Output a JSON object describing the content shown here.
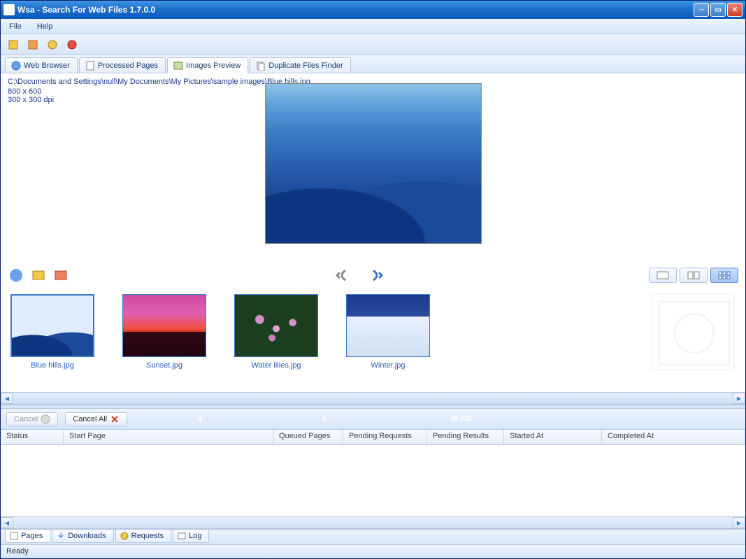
{
  "title": "Wsa - Search For Web Files 1.7.0.0",
  "menu": {
    "file": "File",
    "help": "Help"
  },
  "maintabs": {
    "browser": "Web Browser",
    "processed": "Processed Pages",
    "preview": "Images Preview",
    "dup": "Duplicate Files Finder"
  },
  "preview": {
    "path": "C:\\Documents and Settings\\null\\My Documents\\My Pictures\\sample images\\Blue hills.jpg",
    "size": "800 x 600",
    "dpi": "300 x 300 dpi"
  },
  "thumbs": [
    {
      "label": "Blue hills.jpg",
      "cls": "bluehills",
      "sel": true
    },
    {
      "label": "Sunset.jpg",
      "cls": "sunset",
      "sel": false
    },
    {
      "label": "Water lilies.jpg",
      "cls": "waterlilies",
      "sel": false
    },
    {
      "label": "Winter.jpg",
      "cls": "winter",
      "sel": false
    }
  ],
  "bottom": {
    "cancel": "Cancel",
    "cancel_all": "Cancel All",
    "pages_label": "Pages:",
    "pages_val": "4",
    "files_label": "Files:",
    "files_val": "0",
    "bytes_label": "Bytes:",
    "bytes_val": "39 KB"
  },
  "grid": {
    "status": "Status",
    "start": "Start Page",
    "queued": "Queued Pages",
    "pending_req": "Pending Requests",
    "pending_res": "Pending Results",
    "started": "Started At",
    "completed": "Completed At"
  },
  "btabs": {
    "pages": "Pages",
    "downloads": "Downloads",
    "requests": "Requests",
    "log": "Log"
  },
  "status": "Ready"
}
